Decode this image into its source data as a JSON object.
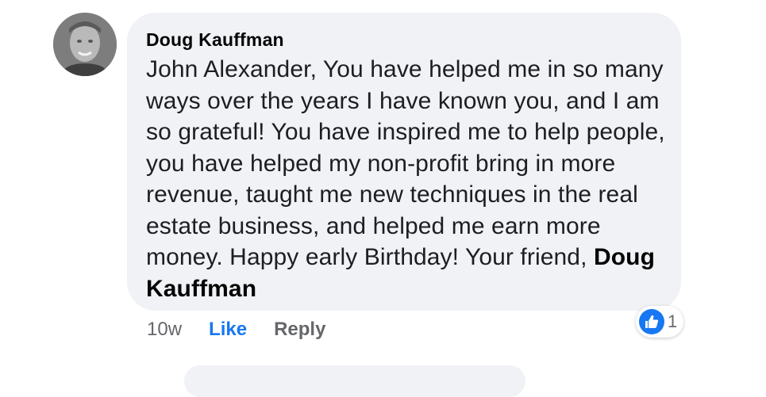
{
  "comment": {
    "author": "Doug Kauffman",
    "text": "John Alexander, You have helped me in so many ways over the years I have known you, and I am so grateful! You have inspired me to help people, you have helped my non-profit bring in more revenue, taught me new techniques in the real estate business, and helped me earn more money. Happy early Birthday! Your friend,",
    "signature": "Doug Kauffman",
    "avatar_icon": "profile-photo"
  },
  "actions": {
    "timestamp": "10w",
    "like_label": "Like",
    "reply_label": "Reply"
  },
  "reactions": {
    "icon": "thumbs-up-icon",
    "count": "1"
  },
  "colors": {
    "bubble_bg": "#f0f2f5",
    "like_blue": "#1877f2",
    "meta_gray": "#65676b"
  }
}
